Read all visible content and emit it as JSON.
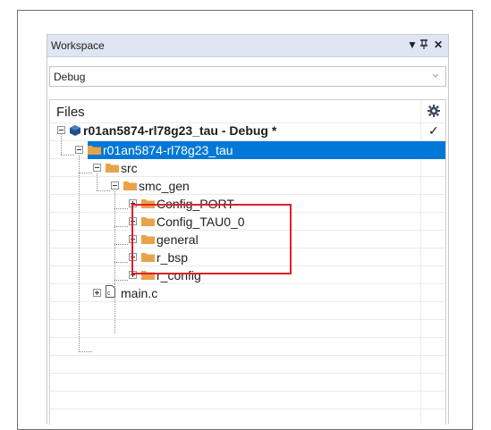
{
  "window": {
    "title": "Workspace",
    "dropdown_glyph": "▼",
    "pin_glyph": "ᵽ",
    "close_glyph": "✕"
  },
  "config_combo": {
    "value": "Debug"
  },
  "files": {
    "header": "Files",
    "check_glyph": "✓",
    "tree": {
      "project": "r01an5874-rl78g23_tau - Debug *",
      "root_folder": "r01an5874-rl78g23_tau",
      "src": "src",
      "smc_gen": "smc_gen",
      "config_port": "Config_PORT",
      "config_tau": "Config_TAU0_0",
      "general": "general",
      "r_bsp": "r_bsp",
      "r_config": "r_config",
      "main_c": "main.c"
    }
  },
  "colors": {
    "selection": "#0078d7",
    "folder": "#e8a34a",
    "highlight_box": "#e0202a",
    "titlebar": "#dde6f2"
  }
}
